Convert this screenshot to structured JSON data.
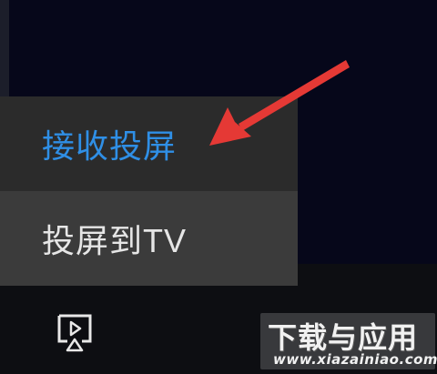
{
  "menu": {
    "items": [
      {
        "label": "接收投屏",
        "state": "highlighted",
        "color": "#2f8fe6"
      },
      {
        "label": "投屏到TV",
        "state": "normal",
        "color": "#e6e6e6"
      }
    ]
  },
  "player": {
    "cast_icon": "screen-cast-icon"
  },
  "annotation": {
    "arrow_color": "#e53935",
    "arrow_icon": "red-arrow-pointer"
  },
  "watermark": {
    "title": "下载与应用",
    "url": "www.xiazainiao.com"
  }
}
